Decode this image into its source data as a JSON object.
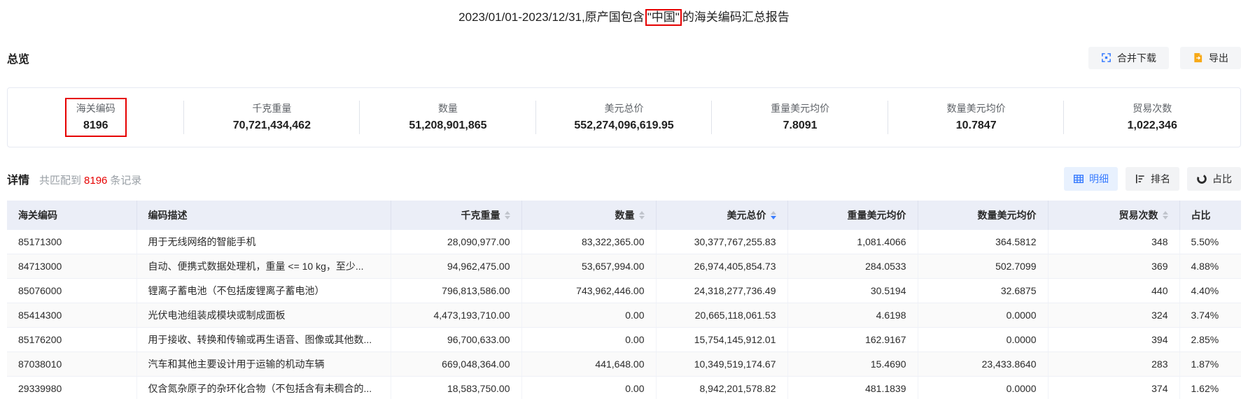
{
  "colors": {
    "red": "#e60000",
    "accent": "#3a7dff",
    "orange": "#f7a917",
    "header_bg": "#ebeef7",
    "btn_bg": "#f4f5f7",
    "btn_bg2": "#f2f3f5",
    "active_bg": "#e8f1fe",
    "border": "#e6e9f2",
    "divider": "#e0e3ea",
    "caret": "#c0c4cc"
  },
  "title": {
    "prefix": "2023/01/01-2023/12/31,原产国包含",
    "highlight": "\"中国\"",
    "suffix": "的海关编码汇总报告"
  },
  "overview": {
    "heading": "总览",
    "buttons": [
      {
        "name": "merge-download-button",
        "icon": "merge-download-icon",
        "label": "合并下载"
      },
      {
        "name": "export-button",
        "icon": "export-icon",
        "label": "导出"
      }
    ],
    "stats": [
      {
        "label": "海关编码",
        "value": "8196",
        "highlighted": true
      },
      {
        "label": "千克重量",
        "value": "70,721,434,462"
      },
      {
        "label": "数量",
        "value": "51,208,901,865"
      },
      {
        "label": "美元总价",
        "value": "552,274,096,619.95"
      },
      {
        "label": "重量美元均价",
        "value": "7.8091"
      },
      {
        "label": "数量美元均价",
        "value": "10.7847"
      },
      {
        "label": "贸易次数",
        "value": "1,022,346"
      }
    ]
  },
  "details": {
    "heading": "详情",
    "match_prefix": "共匹配到",
    "match_count": "8196",
    "match_suffix": "条记录",
    "view_buttons": [
      {
        "name": "view-detail-button",
        "icon": "table-grid-icon",
        "label": "明细",
        "active": true
      },
      {
        "name": "view-ranking-button",
        "icon": "ranking-icon",
        "label": "排名",
        "active": false
      },
      {
        "name": "view-share-button",
        "icon": "pie-chart-icon",
        "label": "占比",
        "active": false
      }
    ]
  },
  "table": {
    "columns": [
      {
        "key": "hs-code",
        "label": "海关编码",
        "align": "left",
        "sortable": false
      },
      {
        "key": "description",
        "label": "编码描述",
        "align": "left",
        "sortable": false
      },
      {
        "key": "weight-kg",
        "label": "千克重量",
        "align": "right",
        "sortable": true,
        "sort": "none"
      },
      {
        "key": "quantity",
        "label": "数量",
        "align": "right",
        "sortable": true,
        "sort": "none"
      },
      {
        "key": "total-usd",
        "label": "美元总价",
        "align": "right",
        "sortable": true,
        "sort": "desc"
      },
      {
        "key": "usd-per-kg",
        "label": "重量美元均价",
        "align": "right",
        "sortable": false
      },
      {
        "key": "usd-per-qty",
        "label": "数量美元均价",
        "align": "right",
        "sortable": false
      },
      {
        "key": "trade-count",
        "label": "贸易次数",
        "align": "right",
        "sortable": true,
        "sort": "none"
      },
      {
        "key": "share",
        "label": "占比",
        "align": "left",
        "sortable": false
      }
    ],
    "rows": [
      [
        "85171300",
        "用于无线网络的智能手机",
        "28,090,977.00",
        "83,322,365.00",
        "30,377,767,255.83",
        "1,081.4066",
        "364.5812",
        "348",
        "5.50%"
      ],
      [
        "84713000",
        "自动、便携式数据处理机，重量 <= 10 kg，至少...",
        "94,962,475.00",
        "53,657,994.00",
        "26,974,405,854.73",
        "284.0533",
        "502.7099",
        "369",
        "4.88%"
      ],
      [
        "85076000",
        "锂离子蓄电池（不包括废锂离子蓄电池）",
        "796,813,586.00",
        "743,962,446.00",
        "24,318,277,736.49",
        "30.5194",
        "32.6875",
        "440",
        "4.40%"
      ],
      [
        "85414300",
        "光伏电池组装成模块或制成面板",
        "4,473,193,710.00",
        "0.00",
        "20,665,118,061.53",
        "4.6198",
        "0.0000",
        "324",
        "3.74%"
      ],
      [
        "85176200",
        "用于接收、转换和传输或再生语音、图像或其他数...",
        "96,700,633.00",
        "0.00",
        "15,754,145,912.01",
        "162.9167",
        "0.0000",
        "394",
        "2.85%"
      ],
      [
        "87038010",
        "汽车和其他主要设计用于运输的机动车辆",
        "669,048,364.00",
        "441,648.00",
        "10,349,519,174.67",
        "15.4690",
        "23,433.8640",
        "283",
        "1.87%"
      ],
      [
        "29339980",
        "仅含氮杂原子的杂环化合物（不包括含有未稠合的...",
        "18,583,750.00",
        "0.00",
        "8,942,201,578.82",
        "481.1839",
        "0.0000",
        "374",
        "1.62%"
      ]
    ]
  }
}
